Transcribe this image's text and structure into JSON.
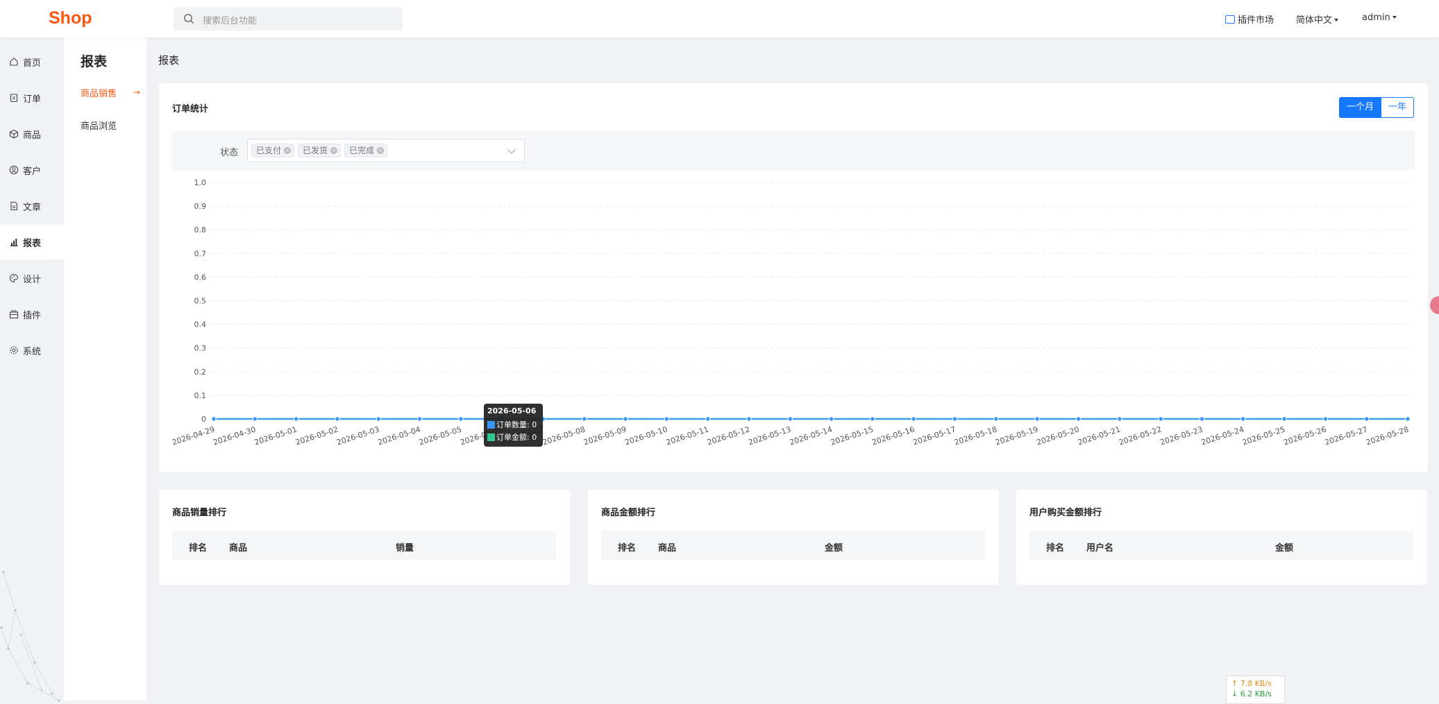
{
  "header": {
    "logo": "Shop",
    "search_placeholder": "搜索后台功能",
    "plugin_market": "插件市场",
    "language": "简体中文",
    "user": "admin"
  },
  "sidebar": {
    "items": [
      {
        "label": "首页",
        "icon": "home-icon"
      },
      {
        "label": "订单",
        "icon": "clipboard-icon"
      },
      {
        "label": "商品",
        "icon": "box-icon"
      },
      {
        "label": "客户",
        "icon": "user-circle-icon"
      },
      {
        "label": "文章",
        "icon": "document-icon"
      },
      {
        "label": "报表",
        "icon": "bar-chart-icon",
        "active": true
      },
      {
        "label": "设计",
        "icon": "palette-icon"
      },
      {
        "label": "插件",
        "icon": "plugin-icon"
      },
      {
        "label": "系统",
        "icon": "gear-icon"
      }
    ]
  },
  "subnav": {
    "title": "报表",
    "items": [
      {
        "label": "商品销售",
        "active": true
      },
      {
        "label": "商品浏览"
      }
    ],
    "arrow": "→"
  },
  "page": {
    "title": "报表"
  },
  "order_stats": {
    "title": "订单统计",
    "range_buttons": [
      "一个月",
      "一年"
    ],
    "active_range": "一个月",
    "filter_label": "状态",
    "status_tags": [
      "已支付",
      "已发货",
      "已完成"
    ]
  },
  "chart_data": {
    "type": "line",
    "x": [
      "2026-04-29",
      "2026-04-30",
      "2026-05-01",
      "2026-05-02",
      "2026-05-03",
      "2026-05-04",
      "2026-05-05",
      "2026-05-06",
      "2026-05-07",
      "2026-05-08",
      "2026-05-09",
      "2026-05-10",
      "2026-05-11",
      "2026-05-12",
      "2026-05-13",
      "2026-05-14",
      "2026-05-15",
      "2026-05-16",
      "2026-05-17",
      "2026-05-18",
      "2026-05-19",
      "2026-05-20",
      "2026-05-21",
      "2026-05-22",
      "2026-05-23",
      "2026-05-24",
      "2026-05-25",
      "2026-05-26",
      "2026-05-27",
      "2026-05-28"
    ],
    "series": [
      {
        "name": "订单数量",
        "color": "#3a95f4",
        "values": [
          0,
          0,
          0,
          0,
          0,
          0,
          0,
          0,
          0,
          0,
          0,
          0,
          0,
          0,
          0,
          0,
          0,
          0,
          0,
          0,
          0,
          0,
          0,
          0,
          0,
          0,
          0,
          0,
          0,
          0
        ]
      },
      {
        "name": "订单金额",
        "color": "#2ec98f",
        "values": [
          0,
          0,
          0,
          0,
          0,
          0,
          0,
          0,
          0,
          0,
          0,
          0,
          0,
          0,
          0,
          0,
          0,
          0,
          0,
          0,
          0,
          0,
          0,
          0,
          0,
          0,
          0,
          0,
          0,
          0
        ]
      }
    ],
    "yticks": [
      "0",
      "0.1",
      "0.2",
      "0.3",
      "0.4",
      "0.5",
      "0.6",
      "0.7",
      "0.8",
      "0.9",
      "1.0"
    ],
    "ylim": [
      0,
      1
    ],
    "grid": true,
    "tooltip": {
      "date": "2026-05-06",
      "rows": [
        "订单数量: 0",
        "订单金额: 0"
      ]
    }
  },
  "rankings": [
    {
      "title": "商品销量排行",
      "columns": [
        "排名",
        "商品",
        "销量"
      ]
    },
    {
      "title": "商品金额排行",
      "columns": [
        "排名",
        "商品",
        "金额"
      ]
    },
    {
      "title": "用户购买金额排行",
      "columns": [
        "排名",
        "用户名",
        "金额"
      ]
    }
  ],
  "network": {
    "up": "↑ 7.8 KB/s",
    "down": "↓ 6.2 KB/s"
  },
  "colors": {
    "brand": "#fd560f",
    "primary": "#1677ff"
  }
}
